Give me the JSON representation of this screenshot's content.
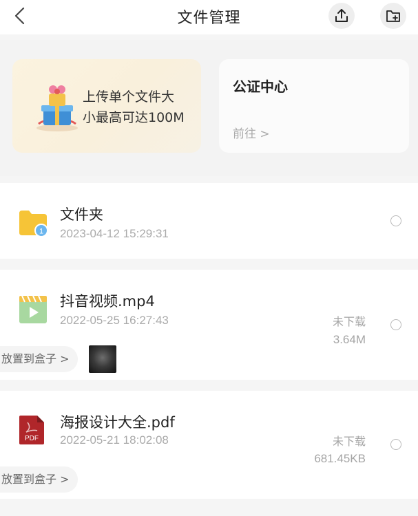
{
  "header": {
    "title": "文件管理",
    "back_icon": "chevron-left-icon",
    "upload_icon": "upload-icon",
    "new_folder_icon": "new-folder-icon"
  },
  "promo": {
    "text_line1": "上传单个文件大",
    "text_line2": "小最高可达100M",
    "icon": "gift-box-icon"
  },
  "notary": {
    "title": "公证中心",
    "link": "前往 >"
  },
  "files": [
    {
      "name": "文件夹",
      "date": "2023-04-12 15:29:31",
      "icon": "folder-icon",
      "badge": "1"
    },
    {
      "name": "抖音视频.mp4",
      "date": "2022-05-25 16:27:43",
      "status": "未下载",
      "size": "3.64M",
      "icon": "video-file-icon",
      "box_action": "放置到盒子 >"
    },
    {
      "name": "海报设计大全.pdf",
      "date": "2022-05-21 18:02:08",
      "status": "未下载",
      "size": "681.45KB",
      "icon": "pdf-file-icon",
      "pdf_label": "PDF",
      "box_action": "放置到盒子 >"
    }
  ],
  "colors": {
    "background": "#f5f5f5",
    "card": "#ffffff",
    "promo_bg": "#fbf3df",
    "muted_text": "#aaaaaa",
    "folder_yellow": "#f6c437",
    "badge_blue": "#6bb6ee",
    "pdf_red": "#b0262a",
    "video_green": "#a8d8a0"
  }
}
